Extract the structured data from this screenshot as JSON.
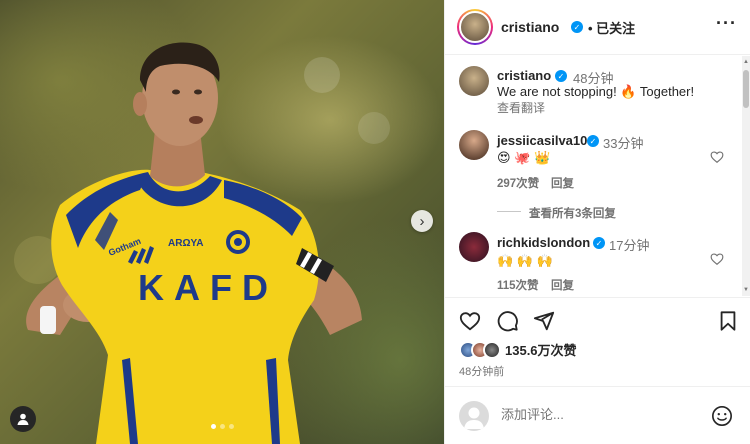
{
  "post": {
    "carousel": {
      "total_slides": 3,
      "active_slide": 1,
      "next_icon": "chevron-right-icon"
    },
    "author": {
      "username": "cristiano",
      "verified": true,
      "follow_status": "已关注"
    },
    "caption": {
      "username": "cristiano",
      "time": "48分钟",
      "text": "We are not stopping! 🔥 Together!",
      "translate": "查看翻译"
    },
    "comments": [
      {
        "username": "jessiicasilva10",
        "time": "33分钟",
        "text": "😍 🐙 👑",
        "likes": "297次赞",
        "reply": "回复",
        "view_replies": "查看所有3条回复"
      },
      {
        "username": "richkidslondon",
        "time": "17分钟",
        "text": "🙌 🙌 🙌",
        "likes": "115次赞",
        "reply": "回复"
      }
    ],
    "likes": "135.6万次赞",
    "posted_ago": "48分钟前",
    "add_comment": {
      "placeholder": "添加评论..."
    }
  },
  "colors": {
    "verified": "#0095f6",
    "text": "#262626",
    "secondary": "#737373",
    "jersey_yellow": "#f4d11a",
    "jersey_navy": "#1e3a8a"
  }
}
